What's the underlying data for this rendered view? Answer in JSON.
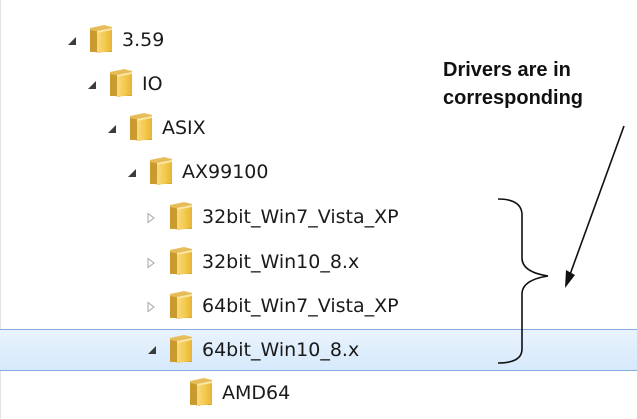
{
  "tree": {
    "nodes": [
      {
        "label": "3.59",
        "state": "expanded",
        "depth": 0
      },
      {
        "label": "IO",
        "state": "expanded",
        "depth": 1
      },
      {
        "label": "ASIX",
        "state": "expanded",
        "depth": 2
      },
      {
        "label": "AX99100",
        "state": "expanded",
        "depth": 3
      },
      {
        "label": "32bit_Win7_Vista_XP",
        "state": "collapsed",
        "depth": 4
      },
      {
        "label": "32bit_Win10_8.x",
        "state": "collapsed",
        "depth": 4
      },
      {
        "label": "64bit_Win7_Vista_XP",
        "state": "collapsed",
        "depth": 4
      },
      {
        "label": "64bit_Win10_8.x",
        "state": "expanded",
        "depth": 4,
        "selected": true
      },
      {
        "label": "AMD64",
        "state": "leaf",
        "depth": 5
      }
    ]
  },
  "annotation": {
    "line1": "Drivers are in",
    "line2": "corresponding"
  },
  "icons": {
    "expanded": "expanded-triangle-icon",
    "collapsed": "collapsed-triangle-icon",
    "folder": "folder-icon"
  },
  "colors": {
    "selection_border": "#84acdd",
    "selection_fill": "#d6e9fb",
    "folder_yellow": "#f3c94b",
    "folder_tab": "#e6b437"
  }
}
